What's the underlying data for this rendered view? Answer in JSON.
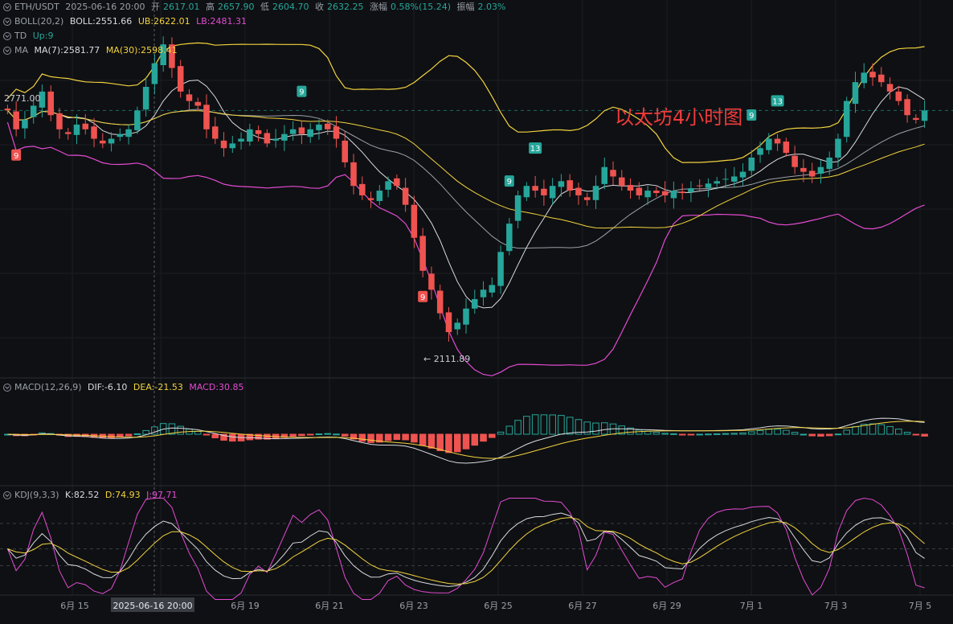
{
  "header": {
    "symbol": "ETH/USDT",
    "datetime": "2025-06-16 20:00",
    "open_label": "开",
    "open": "2617.01",
    "high_label": "高",
    "high": "2657.90",
    "low_label": "低",
    "low": "2604.70",
    "close_label": "收",
    "close": "2632.25",
    "change_label": "涨幅",
    "change": "0.58%(15.24)",
    "amp_label": "振幅",
    "amp": "2.03%"
  },
  "indicators": {
    "boll": {
      "name": "BOLL(20,2)",
      "mid": "BOLL:2551.66",
      "ub": "UB:2622.01",
      "lb": "LB:2481.31"
    },
    "td": {
      "name": "TD",
      "value": "Up:9"
    },
    "ma": {
      "name": "MA",
      "ma7": "MA(7):2581.77",
      "ma30": "MA(30):2598.41"
    },
    "macd": {
      "name": "MACD(12,26,9)",
      "dif": "DIF:-6.10",
      "dea": "DEA:-21.53",
      "macd": "MACD:30.85"
    },
    "kdj": {
      "name": "KDJ(9,3,3)",
      "k": "K:82.52",
      "d": "D:74.93",
      "j": "J:97.71"
    }
  },
  "annotations": {
    "title": "以太坊4小时图",
    "high_label": "2771.00",
    "low_label": "← 2111.89"
  },
  "colors": {
    "up": "#26a69a",
    "down": "#ef5350",
    "ma7": "#d9dbe0",
    "ma30": "#f2d33f",
    "boll_band": "#e34bd3",
    "kdj_k": "#d9dbe0",
    "kdj_d": "#f2d33f",
    "kdj_j": "#e34bd3",
    "title": "#ee3b3b"
  },
  "chart_data": {
    "type": "candlestick",
    "x_ticks": [
      "6月 15",
      "6月 19",
      "6月 21",
      "6月 23",
      "6月 25",
      "6月 27",
      "6月 29",
      "7月 1",
      "7月 3",
      "7月 5"
    ],
    "x_highlight": "2025-06-16 20:00",
    "high_marker": 2771.0,
    "low_marker": 2111.89,
    "td_markers": [
      {
        "label": "9",
        "kind": "down"
      },
      {
        "label": "9",
        "kind": "up"
      },
      {
        "label": "9",
        "kind": "down"
      },
      {
        "label": "9",
        "kind": "up"
      },
      {
        "label": "13",
        "kind": "up"
      },
      {
        "label": "9",
        "kind": "up"
      },
      {
        "label": "13",
        "kind": "up"
      }
    ],
    "close_path": [
      2600,
      2560,
      2580,
      2610,
      2640,
      2590,
      2560,
      2550,
      2570,
      2560,
      2540,
      2530,
      2540,
      2550,
      2560,
      2600,
      2650,
      2700,
      2740,
      2690,
      2640,
      2620,
      2610,
      2560,
      2540,
      2520,
      2530,
      2540,
      2560,
      2550,
      2530,
      2540,
      2550,
      2560,
      2550,
      2560,
      2570,
      2560,
      2540,
      2490,
      2440,
      2420,
      2410,
      2430,
      2450,
      2440,
      2400,
      2330,
      2260,
      2220,
      2170,
      2130,
      2150,
      2180,
      2200,
      2220,
      2230,
      2300,
      2360,
      2420,
      2440,
      2430,
      2420,
      2440,
      2450,
      2430,
      2420,
      2410,
      2440,
      2480,
      2460,
      2440,
      2430,
      2420,
      2430,
      2425,
      2420,
      2430,
      2425,
      2435,
      2440,
      2445,
      2450,
      2455,
      2460,
      2470,
      2500,
      2520,
      2540,
      2530,
      2510,
      2480,
      2470,
      2460,
      2480,
      2500,
      2540,
      2620,
      2660,
      2680,
      2670,
      2660,
      2640,
      2620,
      2590,
      2580,
      2600
    ]
  }
}
